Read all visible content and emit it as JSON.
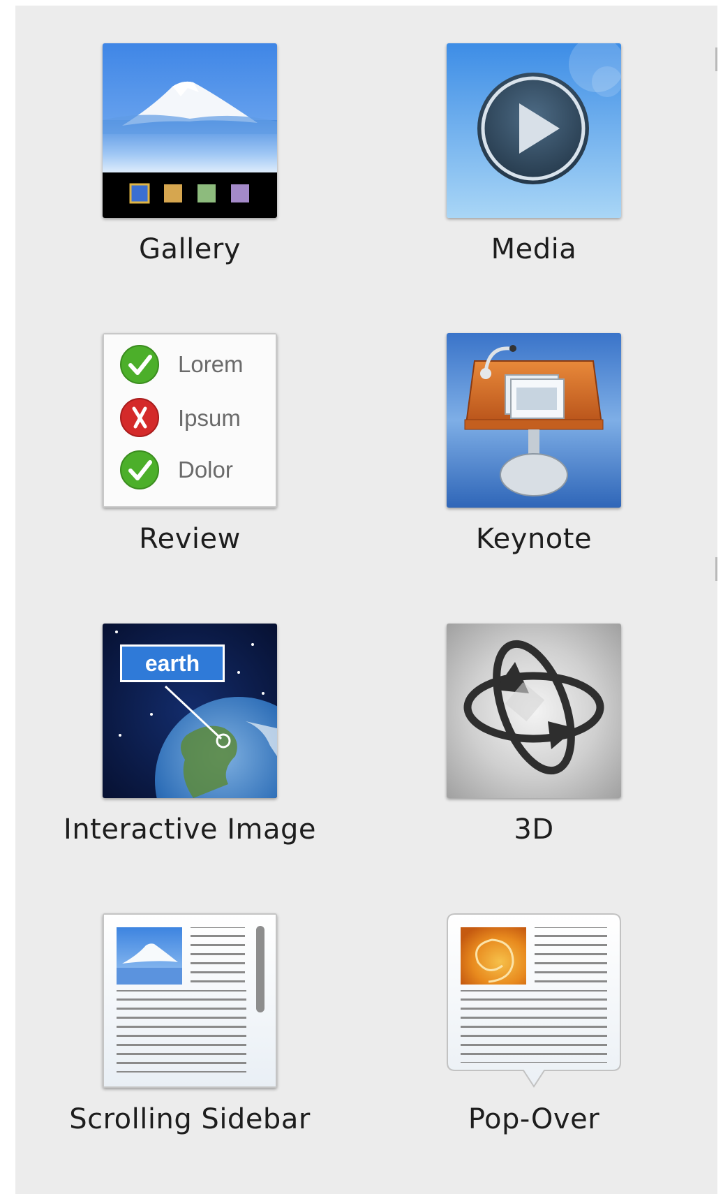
{
  "widgets": [
    {
      "name": "Gallery",
      "icon": "gallery-icon"
    },
    {
      "name": "Media",
      "icon": "media-play-icon"
    },
    {
      "name": "Review",
      "icon": "review-checklist-icon"
    },
    {
      "name": "Keynote",
      "icon": "keynote-podium-icon"
    },
    {
      "name": "Interactive Image",
      "icon": "earth-callout-icon"
    },
    {
      "name": "3D",
      "icon": "rotate-3d-icon"
    },
    {
      "name": "Scrolling Sidebar",
      "icon": "scrolling-sidebar-icon"
    },
    {
      "name": "Pop-Over",
      "icon": "popover-icon"
    }
  ],
  "review_items": [
    {
      "text": "Lorem",
      "status": "correct"
    },
    {
      "text": "Ipsum",
      "status": "incorrect"
    },
    {
      "text": "Dolor",
      "status": "correct"
    }
  ],
  "interactive_image_callout": "earth",
  "colors": {
    "panel_bg": "#ececec",
    "label_text": "#1d1d1d",
    "check_green": "#4caf2a",
    "cross_red": "#d42a2a",
    "keynote_orange": "#d9691f",
    "sky_blue": "#3f86e6"
  }
}
